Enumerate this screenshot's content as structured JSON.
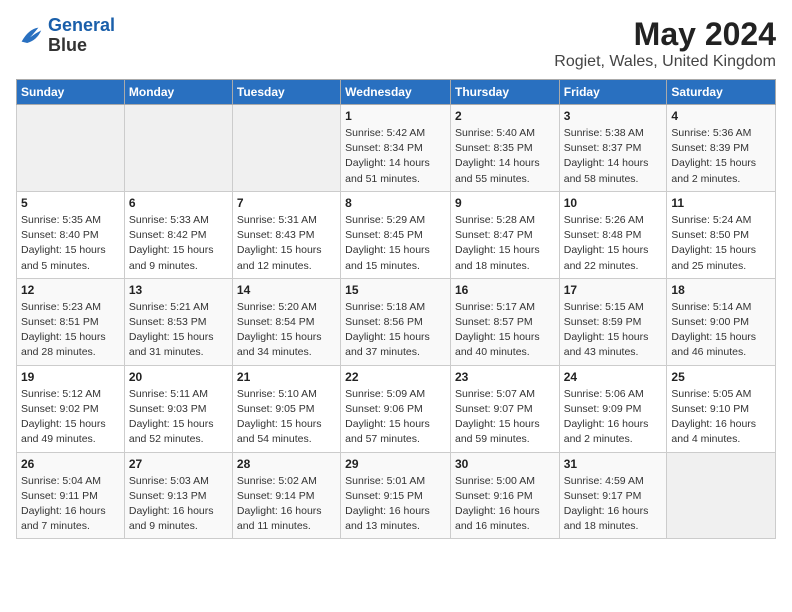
{
  "logo": {
    "line1": "General",
    "line2": "Blue"
  },
  "title": "May 2024",
  "subtitle": "Rogiet, Wales, United Kingdom",
  "days_of_week": [
    "Sunday",
    "Monday",
    "Tuesday",
    "Wednesday",
    "Thursday",
    "Friday",
    "Saturday"
  ],
  "weeks": [
    [
      {
        "day": "",
        "info": ""
      },
      {
        "day": "",
        "info": ""
      },
      {
        "day": "",
        "info": ""
      },
      {
        "day": "1",
        "info": "Sunrise: 5:42 AM\nSunset: 8:34 PM\nDaylight: 14 hours\nand 51 minutes."
      },
      {
        "day": "2",
        "info": "Sunrise: 5:40 AM\nSunset: 8:35 PM\nDaylight: 14 hours\nand 55 minutes."
      },
      {
        "day": "3",
        "info": "Sunrise: 5:38 AM\nSunset: 8:37 PM\nDaylight: 14 hours\nand 58 minutes."
      },
      {
        "day": "4",
        "info": "Sunrise: 5:36 AM\nSunset: 8:39 PM\nDaylight: 15 hours\nand 2 minutes."
      }
    ],
    [
      {
        "day": "5",
        "info": "Sunrise: 5:35 AM\nSunset: 8:40 PM\nDaylight: 15 hours\nand 5 minutes."
      },
      {
        "day": "6",
        "info": "Sunrise: 5:33 AM\nSunset: 8:42 PM\nDaylight: 15 hours\nand 9 minutes."
      },
      {
        "day": "7",
        "info": "Sunrise: 5:31 AM\nSunset: 8:43 PM\nDaylight: 15 hours\nand 12 minutes."
      },
      {
        "day": "8",
        "info": "Sunrise: 5:29 AM\nSunset: 8:45 PM\nDaylight: 15 hours\nand 15 minutes."
      },
      {
        "day": "9",
        "info": "Sunrise: 5:28 AM\nSunset: 8:47 PM\nDaylight: 15 hours\nand 18 minutes."
      },
      {
        "day": "10",
        "info": "Sunrise: 5:26 AM\nSunset: 8:48 PM\nDaylight: 15 hours\nand 22 minutes."
      },
      {
        "day": "11",
        "info": "Sunrise: 5:24 AM\nSunset: 8:50 PM\nDaylight: 15 hours\nand 25 minutes."
      }
    ],
    [
      {
        "day": "12",
        "info": "Sunrise: 5:23 AM\nSunset: 8:51 PM\nDaylight: 15 hours\nand 28 minutes."
      },
      {
        "day": "13",
        "info": "Sunrise: 5:21 AM\nSunset: 8:53 PM\nDaylight: 15 hours\nand 31 minutes."
      },
      {
        "day": "14",
        "info": "Sunrise: 5:20 AM\nSunset: 8:54 PM\nDaylight: 15 hours\nand 34 minutes."
      },
      {
        "day": "15",
        "info": "Sunrise: 5:18 AM\nSunset: 8:56 PM\nDaylight: 15 hours\nand 37 minutes."
      },
      {
        "day": "16",
        "info": "Sunrise: 5:17 AM\nSunset: 8:57 PM\nDaylight: 15 hours\nand 40 minutes."
      },
      {
        "day": "17",
        "info": "Sunrise: 5:15 AM\nSunset: 8:59 PM\nDaylight: 15 hours\nand 43 minutes."
      },
      {
        "day": "18",
        "info": "Sunrise: 5:14 AM\nSunset: 9:00 PM\nDaylight: 15 hours\nand 46 minutes."
      }
    ],
    [
      {
        "day": "19",
        "info": "Sunrise: 5:12 AM\nSunset: 9:02 PM\nDaylight: 15 hours\nand 49 minutes."
      },
      {
        "day": "20",
        "info": "Sunrise: 5:11 AM\nSunset: 9:03 PM\nDaylight: 15 hours\nand 52 minutes."
      },
      {
        "day": "21",
        "info": "Sunrise: 5:10 AM\nSunset: 9:05 PM\nDaylight: 15 hours\nand 54 minutes."
      },
      {
        "day": "22",
        "info": "Sunrise: 5:09 AM\nSunset: 9:06 PM\nDaylight: 15 hours\nand 57 minutes."
      },
      {
        "day": "23",
        "info": "Sunrise: 5:07 AM\nSunset: 9:07 PM\nDaylight: 15 hours\nand 59 minutes."
      },
      {
        "day": "24",
        "info": "Sunrise: 5:06 AM\nSunset: 9:09 PM\nDaylight: 16 hours\nand 2 minutes."
      },
      {
        "day": "25",
        "info": "Sunrise: 5:05 AM\nSunset: 9:10 PM\nDaylight: 16 hours\nand 4 minutes."
      }
    ],
    [
      {
        "day": "26",
        "info": "Sunrise: 5:04 AM\nSunset: 9:11 PM\nDaylight: 16 hours\nand 7 minutes."
      },
      {
        "day": "27",
        "info": "Sunrise: 5:03 AM\nSunset: 9:13 PM\nDaylight: 16 hours\nand 9 minutes."
      },
      {
        "day": "28",
        "info": "Sunrise: 5:02 AM\nSunset: 9:14 PM\nDaylight: 16 hours\nand 11 minutes."
      },
      {
        "day": "29",
        "info": "Sunrise: 5:01 AM\nSunset: 9:15 PM\nDaylight: 16 hours\nand 13 minutes."
      },
      {
        "day": "30",
        "info": "Sunrise: 5:00 AM\nSunset: 9:16 PM\nDaylight: 16 hours\nand 16 minutes."
      },
      {
        "day": "31",
        "info": "Sunrise: 4:59 AM\nSunset: 9:17 PM\nDaylight: 16 hours\nand 18 minutes."
      },
      {
        "day": "",
        "info": ""
      }
    ]
  ]
}
